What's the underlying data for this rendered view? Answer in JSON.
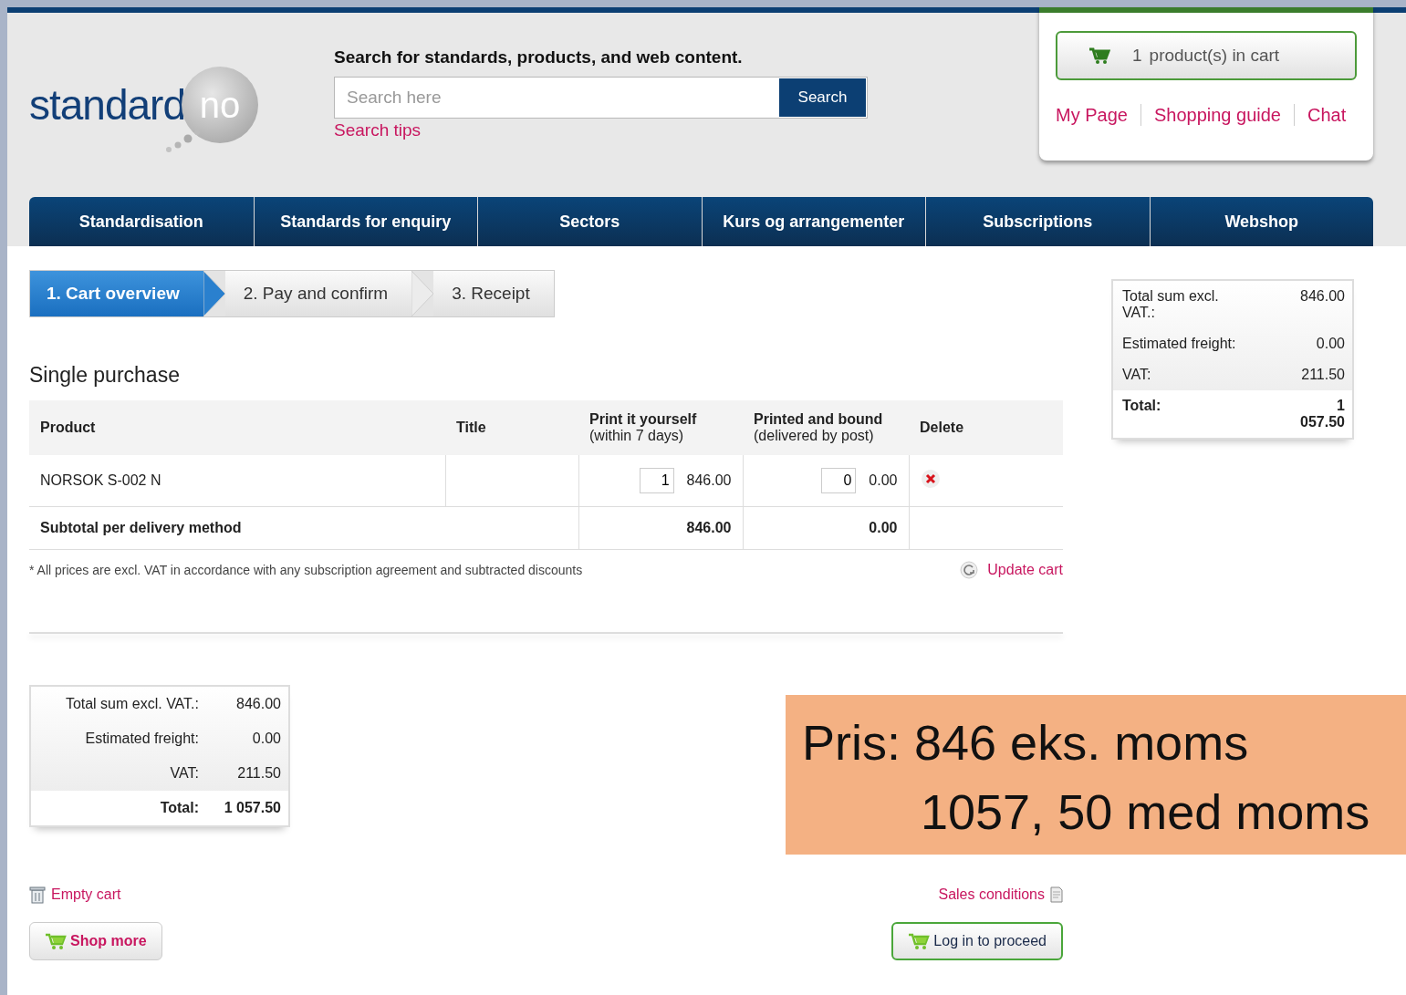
{
  "header": {
    "logo": {
      "main": "standard",
      "suffix": "no"
    },
    "search": {
      "heading": "Search for standards, products, and web content.",
      "placeholder": "Search here",
      "button": "Search",
      "tips": "Search tips"
    },
    "cart": {
      "count": "1",
      "label": "product(s) in cart",
      "links": [
        "My Page",
        "Shopping guide",
        "Chat"
      ]
    }
  },
  "nav": [
    "Standardisation",
    "Standards for enquiry",
    "Sectors",
    "Kurs og arrangementer",
    "Subscriptions",
    "Webshop"
  ],
  "steps": [
    {
      "label": "1. Cart overview",
      "selected": true
    },
    {
      "label": "2. Pay and confirm",
      "selected": false
    },
    {
      "label": "3. Receipt",
      "selected": false
    }
  ],
  "section_title": "Single purchase",
  "table": {
    "columns": [
      {
        "label": "Product"
      },
      {
        "label": "Title"
      },
      {
        "label": "Print it yourself",
        "sub": "(within 7 days)"
      },
      {
        "label": "Printed and bound",
        "sub": "(delivered by post)"
      },
      {
        "label": "Delete"
      }
    ],
    "rows": [
      {
        "product": "NORSOK S-002 N",
        "print_qty": "1",
        "print_price": "846.00",
        "bound_qty": "0",
        "bound_price": "0.00"
      }
    ],
    "subtotal": {
      "label": "Subtotal per delivery method",
      "print": "846.00",
      "bound": "0.00"
    }
  },
  "footnote": "* All prices are excl. VAT in accordance with any subscription agreement and subtracted discounts",
  "update_cart": "Update cart",
  "side_summary": [
    {
      "kind": "line",
      "label": "Total sum excl. VAT.:",
      "value": "846.00"
    },
    {
      "kind": "line",
      "label": "Estimated freight:",
      "value": "0.00"
    },
    {
      "kind": "line",
      "label": "VAT:",
      "value": "211.50"
    },
    {
      "kind": "total",
      "label": "Total:",
      "value": "1 057.50"
    }
  ],
  "summary": [
    {
      "kind": "line",
      "label": "Total sum excl. VAT.:",
      "value": "846.00"
    },
    {
      "kind": "line",
      "label": "Estimated freight:",
      "value": "0.00"
    },
    {
      "kind": "line",
      "label": "VAT:",
      "value": "211.50"
    },
    {
      "kind": "total",
      "label": "Total:",
      "value": "1 057.50"
    }
  ],
  "empty_cart": "Empty cart",
  "sales_conditions": "Sales conditions",
  "shop_more": "Shop more",
  "login": "Log in to proceed",
  "annotation": {
    "lines": [
      "Pris: 846 eks. moms",
      "1057, 50 med moms"
    ]
  }
}
